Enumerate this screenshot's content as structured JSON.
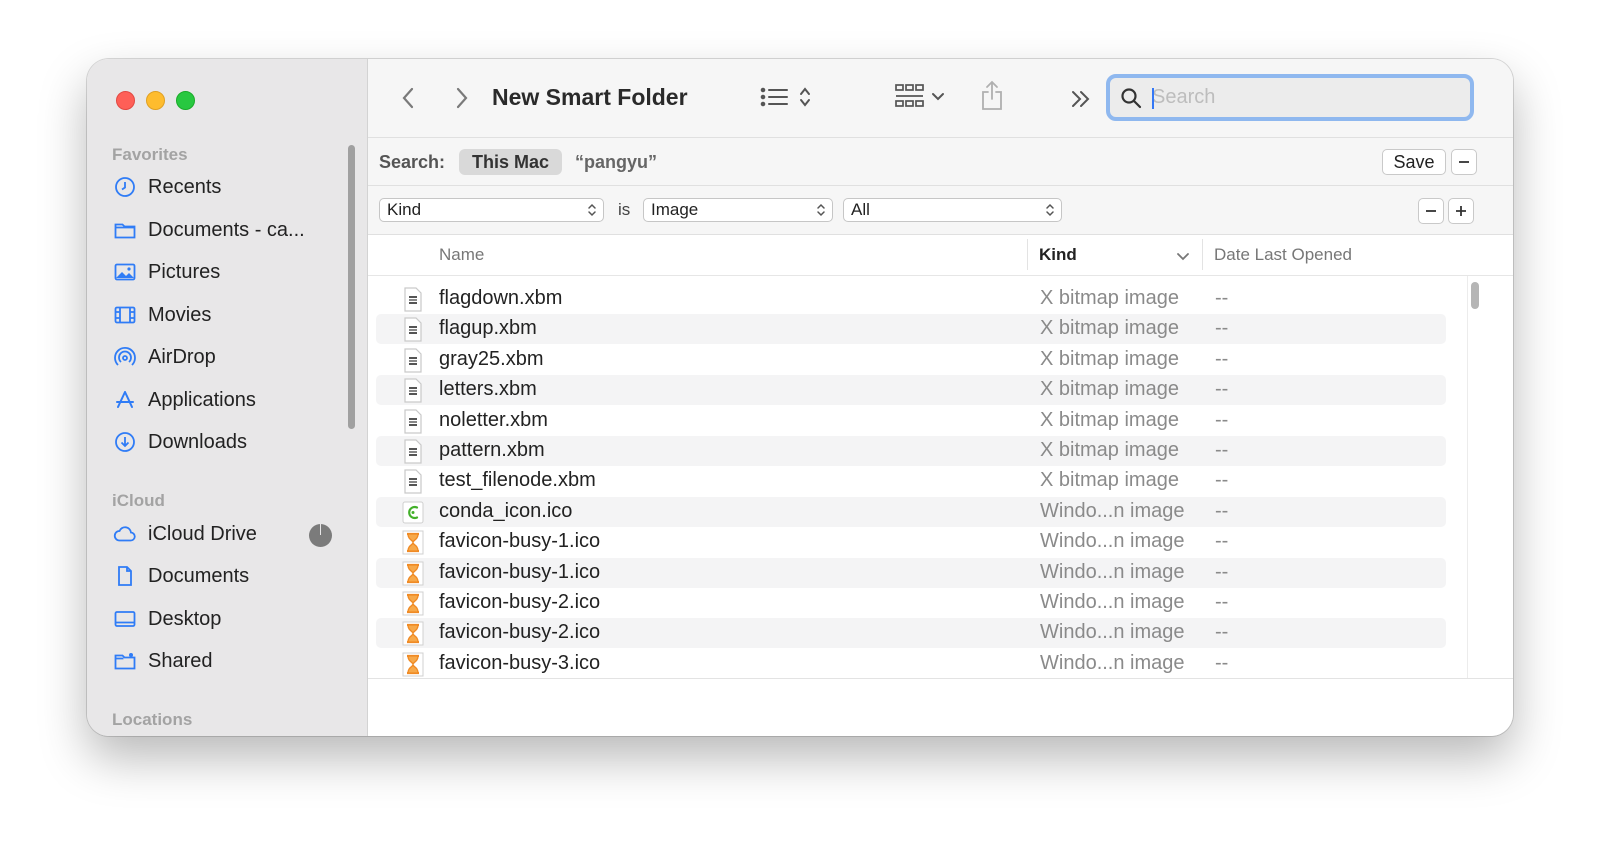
{
  "window": {
    "title": "New Smart Folder"
  },
  "sidebar": {
    "favorites_header": "Favorites",
    "favorites": [
      {
        "label": "Recents",
        "icon": "clock-icon"
      },
      {
        "label": "Documents - ca...",
        "icon": "folder-icon"
      },
      {
        "label": "Pictures",
        "icon": "photo-icon"
      },
      {
        "label": "Movies",
        "icon": "film-icon"
      },
      {
        "label": "AirDrop",
        "icon": "airdrop-icon"
      },
      {
        "label": "Applications",
        "icon": "applications-icon"
      },
      {
        "label": "Downloads",
        "icon": "download-icon"
      }
    ],
    "icloud_header": "iCloud",
    "icloud": [
      {
        "label": "iCloud Drive",
        "icon": "cloud-icon"
      },
      {
        "label": "Documents",
        "icon": "document-icon"
      },
      {
        "label": "Desktop",
        "icon": "desktop-icon"
      },
      {
        "label": "Shared",
        "icon": "shared-folder-icon"
      }
    ],
    "locations_header": "Locations"
  },
  "toolbar": {
    "search_placeholder": "Search"
  },
  "scope": {
    "label": "Search:",
    "active_scope": "This Mac",
    "query": "“pangyu”",
    "save_label": "Save"
  },
  "criteria": {
    "attribute": "Kind",
    "operator": "is",
    "value": "Image",
    "subvalue": "All"
  },
  "columns": {
    "name": "Name",
    "kind": "Kind",
    "date": "Date Last Opened"
  },
  "files": [
    {
      "name": "flagdown.xbm",
      "kind": "X bitmap image",
      "date": "--",
      "icon": "xbm-file-icon"
    },
    {
      "name": "flagup.xbm",
      "kind": "X bitmap image",
      "date": "--",
      "icon": "xbm-file-icon"
    },
    {
      "name": "gray25.xbm",
      "kind": "X bitmap image",
      "date": "--",
      "icon": "xbm-file-icon"
    },
    {
      "name": "letters.xbm",
      "kind": "X bitmap image",
      "date": "--",
      "icon": "xbm-file-icon"
    },
    {
      "name": "noletter.xbm",
      "kind": "X bitmap image",
      "date": "--",
      "icon": "xbm-file-icon"
    },
    {
      "name": "pattern.xbm",
      "kind": "X bitmap image",
      "date": "--",
      "icon": "xbm-file-icon"
    },
    {
      "name": "test_filenode.xbm",
      "kind": "X bitmap image",
      "date": "--",
      "icon": "xbm-file-icon"
    },
    {
      "name": "conda_icon.ico",
      "kind": "Windo...n image",
      "date": "--",
      "icon": "conda-icon"
    },
    {
      "name": "favicon-busy-1.ico",
      "kind": "Windo...n image",
      "date": "--",
      "icon": "hourglass-icon"
    },
    {
      "name": "favicon-busy-1.ico",
      "kind": "Windo...n image",
      "date": "--",
      "icon": "hourglass-icon"
    },
    {
      "name": "favicon-busy-2.ico",
      "kind": "Windo...n image",
      "date": "--",
      "icon": "hourglass-icon"
    },
    {
      "name": "favicon-busy-2.ico",
      "kind": "Windo...n image",
      "date": "--",
      "icon": "hourglass-icon"
    },
    {
      "name": "favicon-busy-3.ico",
      "kind": "Windo...n image",
      "date": "--",
      "icon": "hourglass-icon"
    }
  ],
  "colors": {
    "accent": "#3478f6",
    "sidebar_icon": "#2f7cf6",
    "search_focus": "#8fb8ef",
    "hourglass": "#f08a24"
  }
}
